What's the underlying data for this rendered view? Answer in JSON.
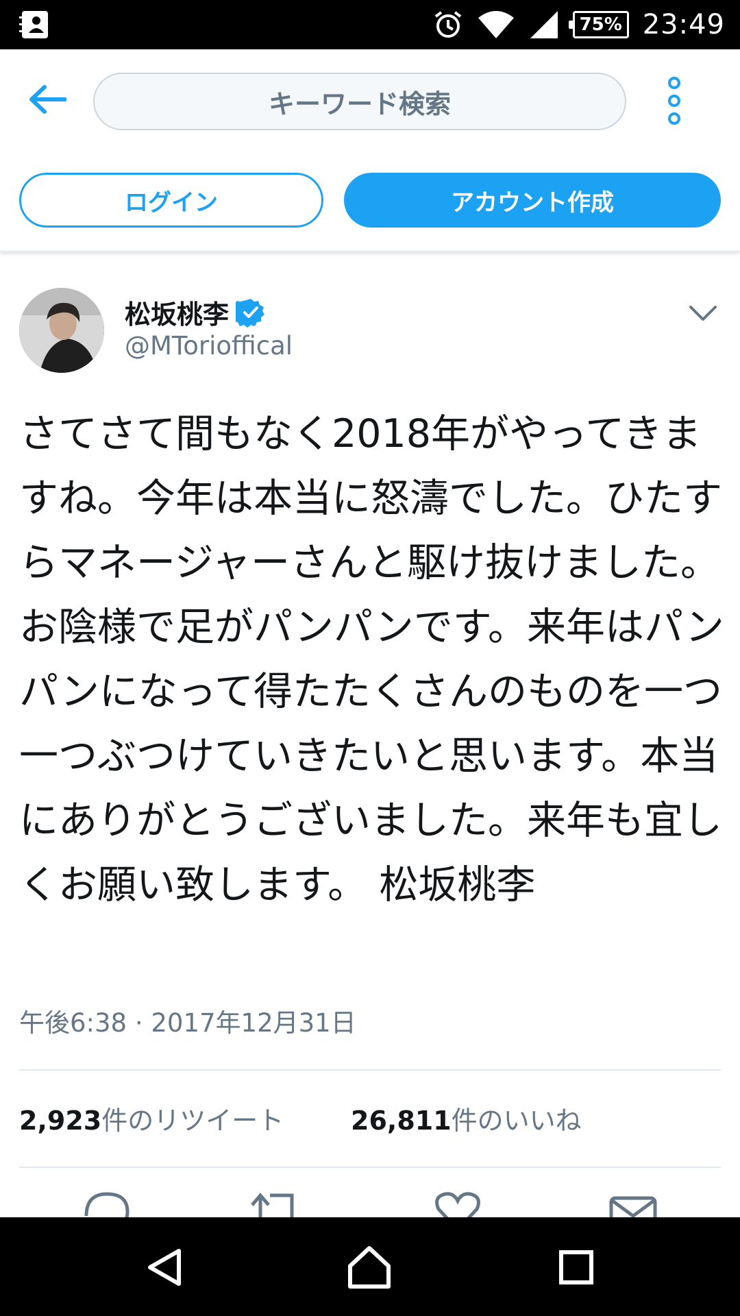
{
  "status_bar": {
    "battery": "75%",
    "time": "23:49",
    "icons": [
      "contacts-icon",
      "alarm-icon",
      "wifi-icon",
      "signal-icon",
      "battery-icon"
    ]
  },
  "header": {
    "search_placeholder": "キーワード検索",
    "login_label": "ログイン",
    "signup_label": "アカウント作成",
    "accent_color": "#1da1f2"
  },
  "tweet": {
    "display_name": "松坂桃李",
    "verified": true,
    "handle": "@MTorioffical",
    "text": "さてさて間もなく2018年がやってきますね。今年は本当に怒濤でした。ひたすらマネージャーさんと駆け抜けました。お陰様で足がパンパンです。来年はパンパンになって得たたくさんのものを一つ一つぶつけていきたいと思います。本当にありがとうございました。来年も宜しくお願い致します。 松坂桃李",
    "timestamp": "午後6:38 · 2017年12月31日",
    "retweet_count": "2,923",
    "retweet_suffix": "件の",
    "retweet_label": "リツイート",
    "like_count": "26,811",
    "like_suffix": "件の",
    "like_label": "いいね"
  },
  "actions": [
    "reply-icon",
    "retweet-icon",
    "like-icon",
    "message-icon"
  ],
  "nav_bar": [
    "back-nav-icon",
    "home-nav-icon",
    "recents-nav-icon"
  ]
}
